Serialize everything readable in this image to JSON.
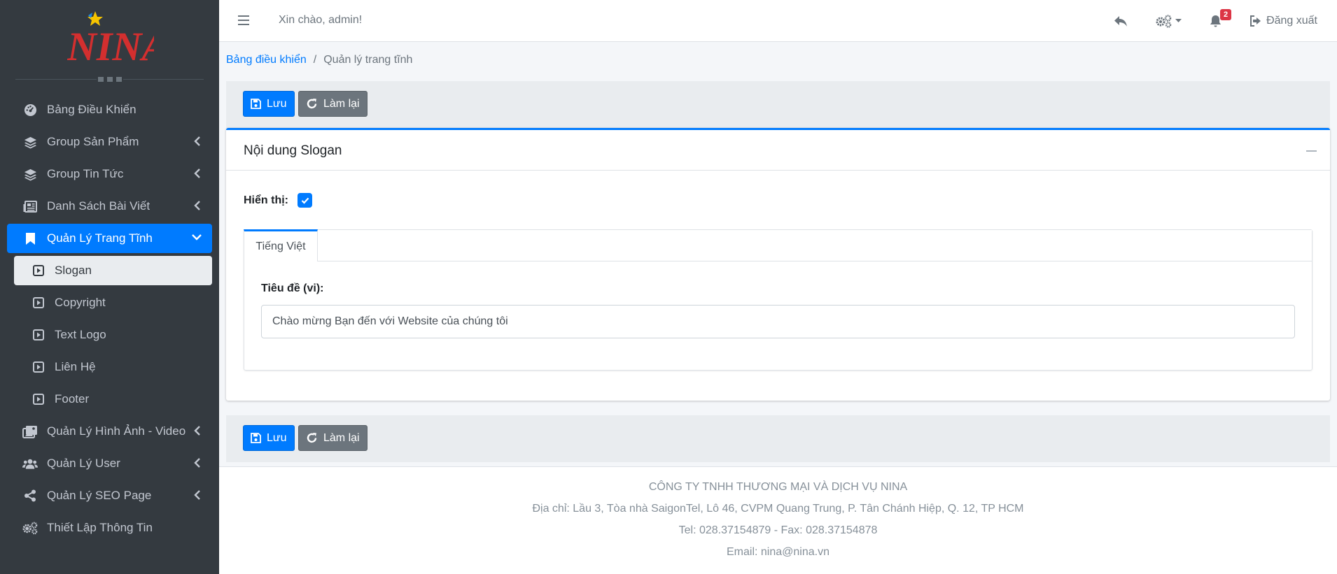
{
  "sidebar": {
    "logo_text": "NINA",
    "items": [
      {
        "label": "Bảng Điều Khiển",
        "icon": "dashboard-icon",
        "has_chevron": false
      },
      {
        "label": "Group Sản Phẩm",
        "icon": "layers-icon",
        "has_chevron": true
      },
      {
        "label": "Group Tin Tức",
        "icon": "layers-icon",
        "has_chevron": true
      },
      {
        "label": "Danh Sách Bài Viết",
        "icon": "newspaper-icon",
        "has_chevron": true
      },
      {
        "label": "Quản Lý Trang Tĩnh",
        "icon": "bookmark-icon",
        "has_chevron": true,
        "active": true,
        "expanded": true
      }
    ],
    "subitems": [
      {
        "label": "Slogan",
        "icon": "caret-square-icon",
        "active": true
      },
      {
        "label": "Copyright",
        "icon": "caret-square-icon"
      },
      {
        "label": "Text Logo",
        "icon": "caret-square-icon"
      },
      {
        "label": "Liên Hệ",
        "icon": "caret-square-icon"
      },
      {
        "label": "Footer",
        "icon": "caret-square-icon"
      }
    ],
    "items_after": [
      {
        "label": "Quản Lý Hình Ảnh - Video",
        "icon": "images-icon",
        "has_chevron": true
      },
      {
        "label": "Quản Lý User",
        "icon": "users-icon",
        "has_chevron": true
      },
      {
        "label": "Quản Lý SEO Page",
        "icon": "share-icon",
        "has_chevron": true
      },
      {
        "label": "Thiết Lập Thông Tin",
        "icon": "cogs-icon",
        "has_chevron": false
      }
    ]
  },
  "topbar": {
    "greeting": "Xin chào, admin!",
    "notification_count": "2",
    "logout_label": "Đăng xuất"
  },
  "breadcrumb": {
    "home": "Bảng điều khiển",
    "separator": "/",
    "current": "Quản lý trang tĩnh"
  },
  "actions": {
    "save_label": "Lưu",
    "reset_label": "Làm lại"
  },
  "card": {
    "title": "Nội dung Slogan",
    "show_label": "Hiển thị:",
    "show_checked": true,
    "tab_label": "Tiếng Việt",
    "field_label": "Tiêu đề (vi):",
    "field_value": "Chào mừng Bạn đến với Website của chúng tôi"
  },
  "footer": {
    "company": "CÔNG TY TNHH THƯƠNG MẠI VÀ DỊCH VỤ NINA",
    "address": "Địa chỉ: Lầu 3, Tòa nhà SaigonTel, Lô 46, CVPM Quang Trung, P. Tân Chánh Hiệp, Q. 12, TP HCM",
    "phone": "Tel: 028.37154879 - Fax: 028.37154878",
    "email": "Email: nina@nina.vn"
  },
  "colors": {
    "sidebar_bg": "#343a40",
    "primary": "#007bff",
    "secondary": "#6c757d",
    "danger": "#dc3545"
  }
}
